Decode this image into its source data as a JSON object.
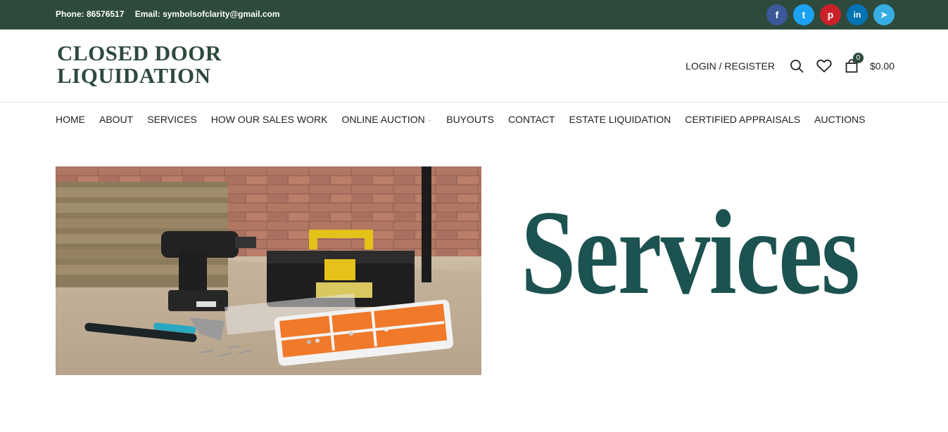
{
  "topbar": {
    "phone": "Phone: 86576517",
    "email": "Email: symbolsofclarity@gmail.com",
    "socials": [
      {
        "name": "facebook-icon",
        "glyph": "f",
        "color": "#3b5998"
      },
      {
        "name": "twitter-icon",
        "glyph": "t",
        "color": "#1da1f2"
      },
      {
        "name": "pinterest-icon",
        "glyph": "p",
        "color": "#cb2027"
      },
      {
        "name": "linkedin-icon",
        "glyph": "in",
        "color": "#0274b3"
      },
      {
        "name": "telegram-icon",
        "glyph": "➤",
        "color": "#37aee2"
      }
    ]
  },
  "header": {
    "logo_line1": "CLOSED DOOR",
    "logo_line2": "LIQUIDATION",
    "login_label": "LOGIN / REGISTER",
    "cart_count": "0",
    "cart_total": "$0.00"
  },
  "nav": {
    "items": [
      "HOME",
      "ABOUT",
      "SERVICES",
      "HOW OUR SALES WORK",
      "ONLINE AUCTION",
      "BUYOUTS",
      "CONTACT",
      "ESTATE LIQUIDATION",
      "CERTIFIED APPRAISALS",
      "AUCTIONS"
    ]
  },
  "hero": {
    "title": "Services"
  },
  "colors": {
    "brand": "#2e4a3d",
    "title": "#1c5250"
  }
}
